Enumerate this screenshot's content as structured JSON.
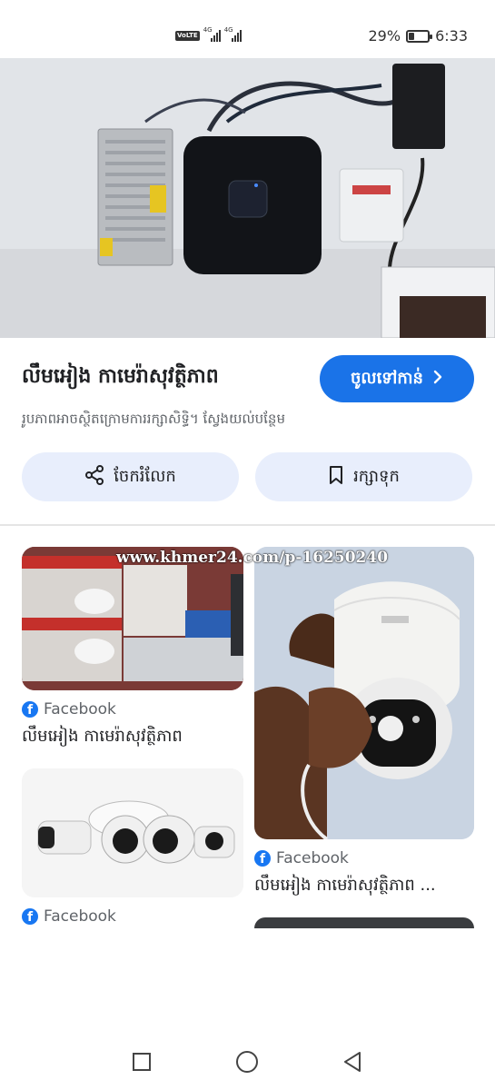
{
  "status_bar": {
    "volte": "VoLTE",
    "net1": "4G",
    "net2": "4G",
    "battery_pct": "29%",
    "battery_level": 0.29,
    "time": "6:33"
  },
  "hero": {
    "image": "nvr-and-power-supply-on-wall"
  },
  "result": {
    "title": "លឹមអៀង កាមេរ៉ាសុវត្ថិភាព",
    "visit_label": "ចូលទៅកាន់",
    "subtitle": "រូបភាពអាចស្ថិតក្រោមការរក្សាសិទ្ធិ។ ស្វែងយល់បន្ថែម",
    "share_label": "ចែករំលែក",
    "save_label": "រក្សាទុក"
  },
  "watermark": "www.khmer24.com/p-16250240",
  "related": [
    {
      "source": "Facebook",
      "title": "លឹមអៀង កាមេរ៉ាសុវត្ថិភាព"
    },
    {
      "source": "Facebook",
      "title": "លឹមអៀង កាមេរ៉ាសុវត្ថិភាព ..."
    },
    {
      "source": "Facebook",
      "title": ""
    }
  ],
  "accent_color": "#1a73e8",
  "icons": [
    "share-icon",
    "bookmark-icon",
    "chevron-right-icon",
    "facebook-icon",
    "recent-apps-icon",
    "home-icon",
    "back-icon"
  ]
}
